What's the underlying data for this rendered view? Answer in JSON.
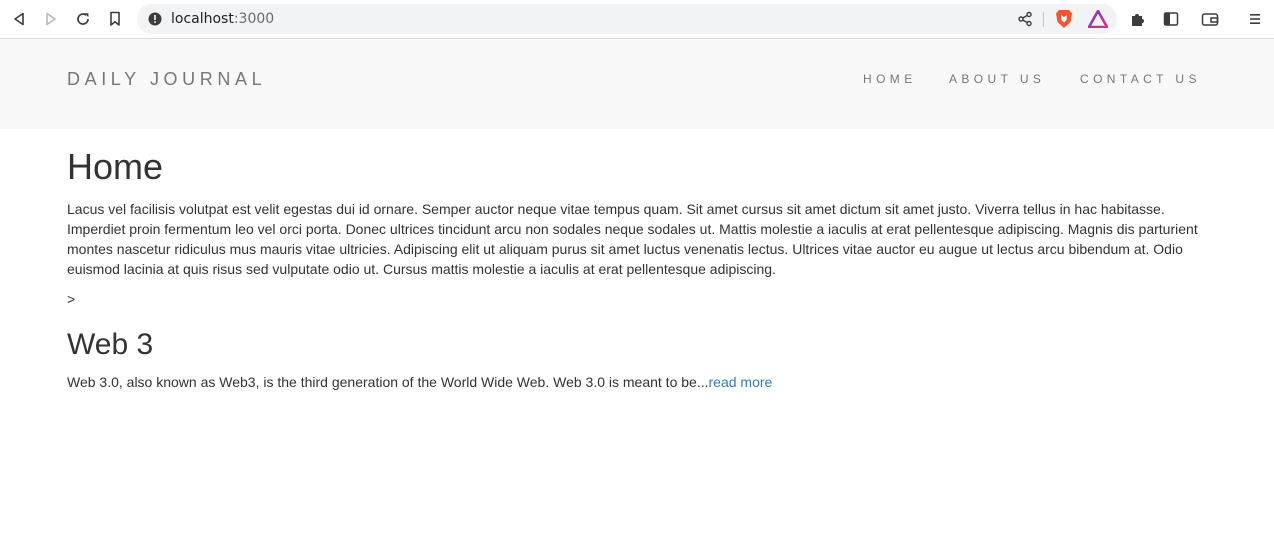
{
  "browser": {
    "url_host": "localhost",
    "url_port": ":3000"
  },
  "site": {
    "brand": "DAILY JOURNAL",
    "nav": [
      {
        "label": "HOME"
      },
      {
        "label": "ABOUT US"
      },
      {
        "label": "CONTACT US"
      }
    ]
  },
  "page": {
    "title": "Home",
    "intro": "Lacus vel facilisis volutpat est velit egestas dui id ornare. Semper auctor neque vitae tempus quam. Sit amet cursus sit amet dictum sit amet justo. Viverra tellus in hac habitasse. Imperdiet proin fermentum leo vel orci porta. Donec ultrices tincidunt arcu non sodales neque sodales ut. Mattis molestie a iaculis at erat pellentesque adipiscing. Magnis dis parturient montes nascetur ridiculus mus mauris vitae ultricies. Adipiscing elit ut aliquam purus sit amet luctus venenatis lectus. Ultrices vitae auctor eu augue ut lectus arcu bibendum at. Odio euismod lacinia at quis risus sed vulputate odio ut. Cursus mattis molestie a iaculis at erat pellentesque adipiscing.",
    "marker": ">",
    "posts": [
      {
        "title": "Web 3",
        "excerpt": "Web 3.0, also known as Web3, is the third generation of the World Wide Web. Web 3.0 is meant to be...",
        "read_more": "read more"
      }
    ]
  },
  "icons": {
    "back": "back-icon",
    "forward": "forward-icon",
    "reload": "reload-icon",
    "bookmark": "bookmark-icon",
    "info": "info-icon",
    "share": "share-icon",
    "brave": "brave-shield-icon",
    "rewards": "brave-rewards-icon",
    "extensions": "puzzle-icon",
    "sidebar": "sidebar-icon",
    "wallet": "wallet-icon",
    "menu": "menu-icon"
  },
  "colors": {
    "header_bg": "#f8f8f8",
    "nav_text": "#777777",
    "body_text": "#333333",
    "link": "#337ab7"
  }
}
